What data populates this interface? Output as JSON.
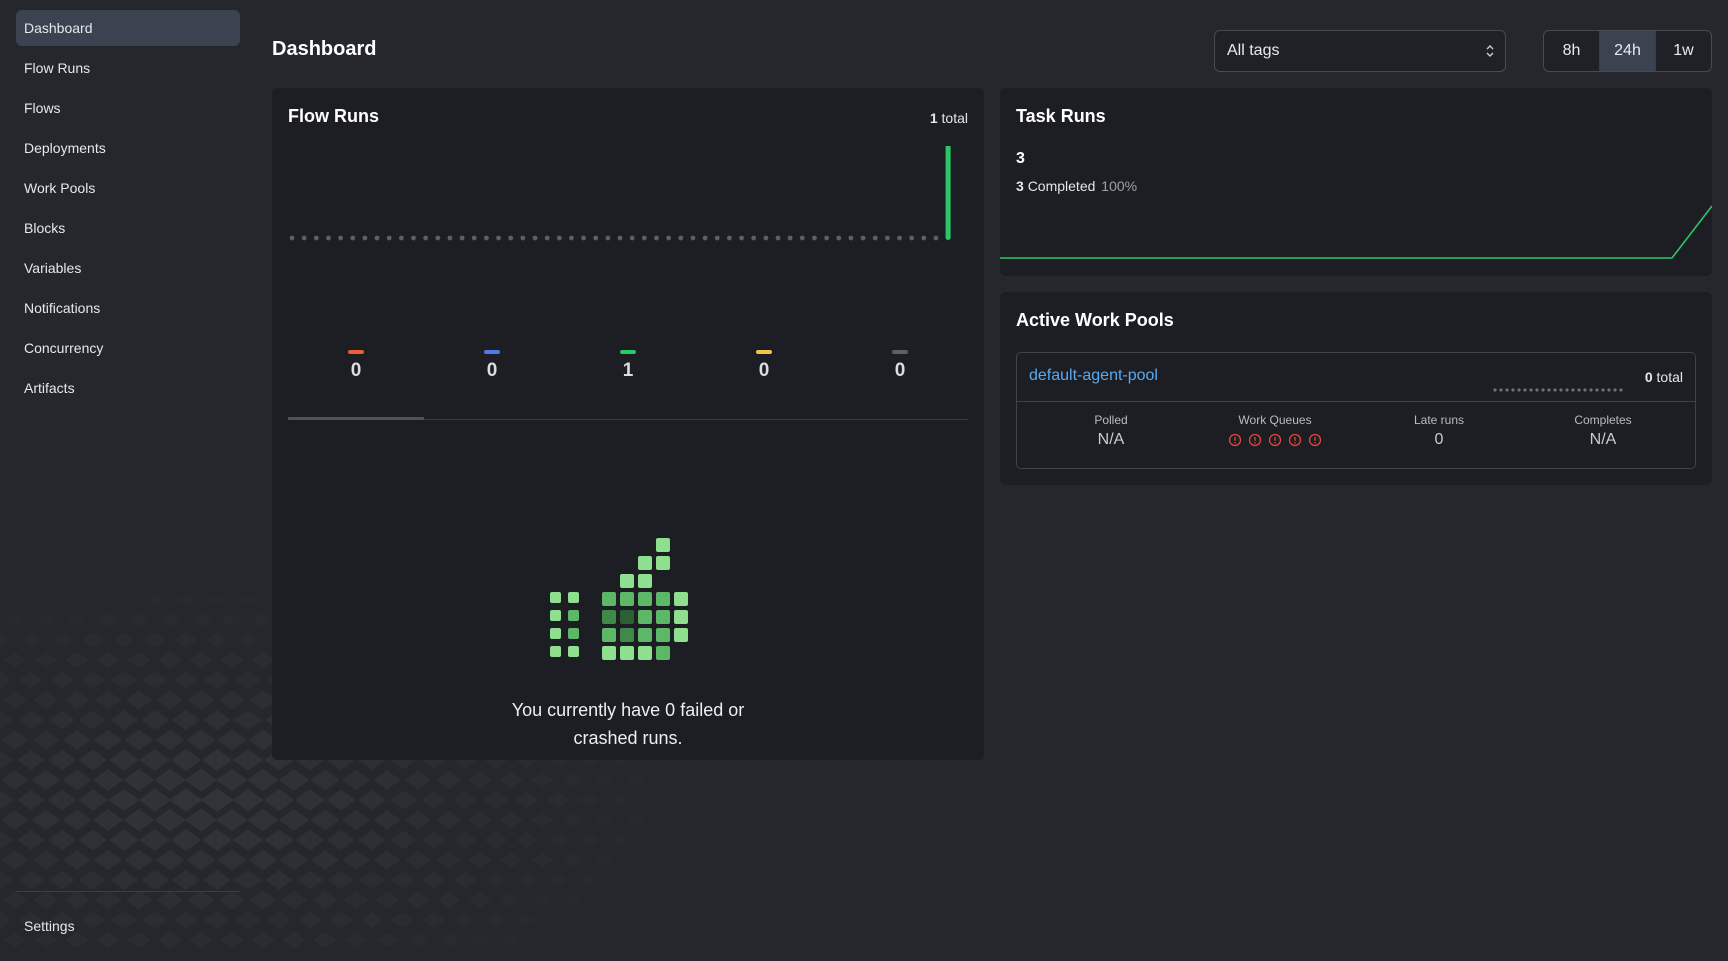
{
  "sidebar": {
    "items": [
      {
        "label": "Dashboard",
        "active": true
      },
      {
        "label": "Flow Runs"
      },
      {
        "label": "Flows"
      },
      {
        "label": "Deployments"
      },
      {
        "label": "Work Pools"
      },
      {
        "label": "Blocks"
      },
      {
        "label": "Variables"
      },
      {
        "label": "Notifications"
      },
      {
        "label": "Concurrency"
      },
      {
        "label": "Artifacts"
      }
    ],
    "settings_label": "Settings"
  },
  "header": {
    "title": "Dashboard",
    "tags_select": {
      "value": "All tags"
    },
    "time_ranges": [
      {
        "label": "8h"
      },
      {
        "label": "24h",
        "active": true
      },
      {
        "label": "1w"
      }
    ]
  },
  "flow_runs": {
    "title": "Flow Runs",
    "total_count": "1",
    "total_suffix": "total",
    "states": [
      {
        "key": "failed",
        "count": "0",
        "color": "#ef5d3a"
      },
      {
        "key": "running",
        "count": "0",
        "color": "#5078e6"
      },
      {
        "key": "completed",
        "count": "1",
        "color": "#2ac767"
      },
      {
        "key": "late",
        "count": "0",
        "color": "#f0c24e"
      },
      {
        "key": "cancelled",
        "count": "0",
        "color": "#5b5f67"
      }
    ],
    "selected_state": "failed",
    "empty_message": "You currently have 0 failed or crashed runs."
  },
  "task_runs": {
    "title": "Task Runs",
    "count": "3",
    "completed_count": "3",
    "completed_label": "Completed",
    "completed_pct": "100%"
  },
  "work_pools": {
    "title": "Active Work Pools",
    "pools": [
      {
        "name": "default-agent-pool",
        "total_count": "0",
        "total_suffix": "total",
        "stats": {
          "polled_label": "Polled",
          "polled_value": "N/A",
          "queues_label": "Work Queues",
          "queue_count": 5,
          "queue_status_color": "#e0463c",
          "late_label": "Late runs",
          "late_value": "0",
          "completes_label": "Completes",
          "completes_value": "N/A"
        }
      }
    ]
  },
  "chart_data": [
    {
      "type": "bar",
      "buckets": 55,
      "values": [
        0,
        0,
        0,
        0,
        0,
        0,
        0,
        0,
        0,
        0,
        0,
        0,
        0,
        0,
        0,
        0,
        0,
        0,
        0,
        0,
        0,
        0,
        0,
        0,
        0,
        0,
        0,
        0,
        0,
        0,
        0,
        0,
        0,
        0,
        0,
        0,
        0,
        0,
        0,
        0,
        0,
        0,
        0,
        0,
        0,
        0,
        0,
        0,
        0,
        0,
        0,
        0,
        0,
        0,
        1
      ],
      "colors": {
        "completed": "#2ac767",
        "empty": "#5b5f67"
      }
    },
    {
      "type": "line",
      "points": 50,
      "values": [
        0,
        0,
        0,
        0,
        0,
        0,
        0,
        0,
        0,
        0,
        0,
        0,
        0,
        0,
        0,
        0,
        0,
        0,
        0,
        0,
        0,
        0,
        0,
        0,
        0,
        0,
        0,
        0,
        0,
        0,
        0,
        0,
        0,
        0,
        0,
        0,
        0,
        0,
        0,
        0,
        0,
        0,
        0,
        0,
        0,
        0,
        0,
        0,
        0,
        3
      ],
      "color": "#2ac767"
    }
  ]
}
